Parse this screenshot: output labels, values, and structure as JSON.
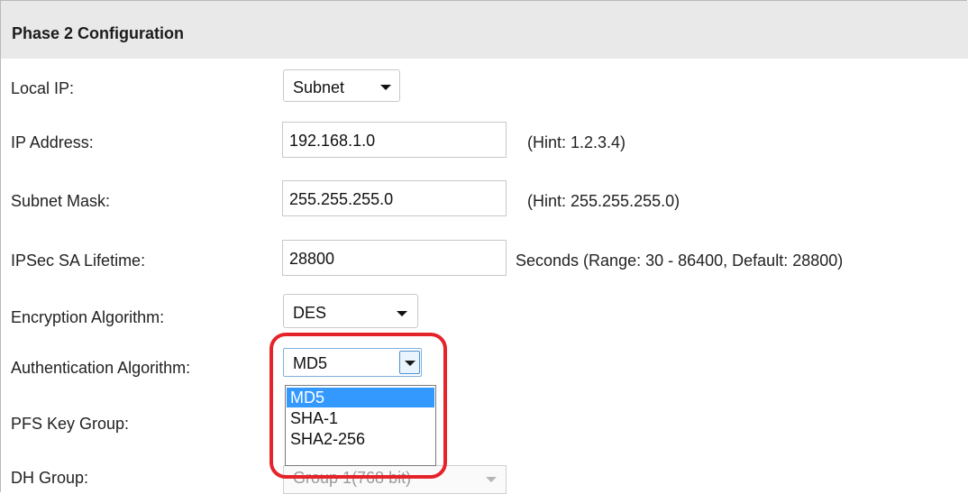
{
  "section": {
    "title": "Phase 2 Configuration"
  },
  "local_ip": {
    "label": "Local IP:",
    "value": "Subnet"
  },
  "ip_address": {
    "label": "IP Address:",
    "value": "192.168.1.0",
    "hint": "(Hint: 1.2.3.4)"
  },
  "subnet_mask": {
    "label": "Subnet Mask:",
    "value": "255.255.255.0",
    "hint": "(Hint: 255.255.255.0)"
  },
  "ipsec_lifetime": {
    "label": "IPSec SA Lifetime:",
    "value": "28800",
    "hint": "Seconds  (Range: 30 - 86400, Default: 28800)"
  },
  "encryption": {
    "label": "Encryption Algorithm:",
    "value": "DES"
  },
  "authentication": {
    "label": "Authentication Algorithm:",
    "value": "MD5",
    "options": [
      "MD5",
      "SHA-1",
      "SHA2-256"
    ],
    "selected_index": 0
  },
  "pfs": {
    "label": "PFS Key Group:"
  },
  "dh_group": {
    "label": "DH Group:",
    "value": "Group 1(768 bit)"
  },
  "colors": {
    "highlight": "#e5232a",
    "selection": "#3399ff",
    "header_bg": "#e9e9e9"
  },
  "icons": {
    "dropdown": "chevron-down-icon"
  }
}
